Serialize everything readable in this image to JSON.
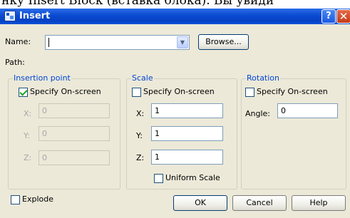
{
  "background_caption": "нку Insert Block (вставка блока). Вы увиди",
  "window": {
    "title": "Insert"
  },
  "titlebar": {
    "help_label": "?",
    "close_label": "✕"
  },
  "name_row": {
    "label": "Name:",
    "value": "",
    "browse_label": "Browse..."
  },
  "path": {
    "label": "Path:"
  },
  "insertion_point": {
    "legend": "Insertion point",
    "specify_label": "Specify On-screen",
    "specify_checked": true,
    "x_label": "X:",
    "x_value": "0",
    "y_label": "Y:",
    "y_value": "0",
    "z_label": "Z:",
    "z_value": "0"
  },
  "scale": {
    "legend": "Scale",
    "specify_label": "Specify On-screen",
    "specify_checked": false,
    "x_label": "X:",
    "x_value": "1",
    "y_label": "Y:",
    "y_value": "1",
    "z_label": "Z:",
    "z_value": "1",
    "uniform_label": "Uniform Scale",
    "uniform_checked": false
  },
  "rotation": {
    "legend": "Rotation",
    "specify_label": "Specify On-screen",
    "specify_checked": false,
    "angle_label": "Angle:",
    "angle_value": "0"
  },
  "footer": {
    "explode_label": "Explode",
    "explode_checked": false,
    "ok_label": "OK",
    "cancel_label": "Cancel",
    "help_label": "Help"
  },
  "icons": {
    "combo_arrow": "chevron-down-icon",
    "app": "insert-block-icon"
  }
}
